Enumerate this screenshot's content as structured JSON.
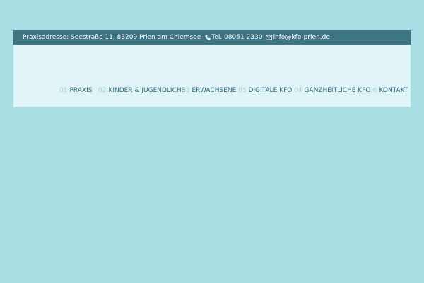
{
  "topbar": {
    "address": "Praxisadresse: Seestraße 11, 83209 Prien am Chiemsee",
    "phone": "Tel. 08051 2330",
    "email": "info@kfo-prien.de",
    "icons": {
      "phone": "phone-icon",
      "email": "mail-icon"
    }
  },
  "nav": {
    "items": [
      {
        "num": "01",
        "label": "PRAXIS"
      },
      {
        "num": "02",
        "label": "KINDER & JUGENDLICHE"
      },
      {
        "num": "03",
        "label": "ERWACHSENE"
      },
      {
        "num": "05",
        "label": "DIGITALE KFO"
      },
      {
        "num": "04",
        "label": "GANZHEITLICHE KFO"
      },
      {
        "num": "06",
        "label": "KONTAKT"
      }
    ]
  },
  "colors": {
    "page_background": "#a8dde4",
    "header_background": "#e0f4f7",
    "topbar_background": "#3d7582",
    "nav_text": "#2f6b7a",
    "nav_number": "#a9cfd6"
  }
}
